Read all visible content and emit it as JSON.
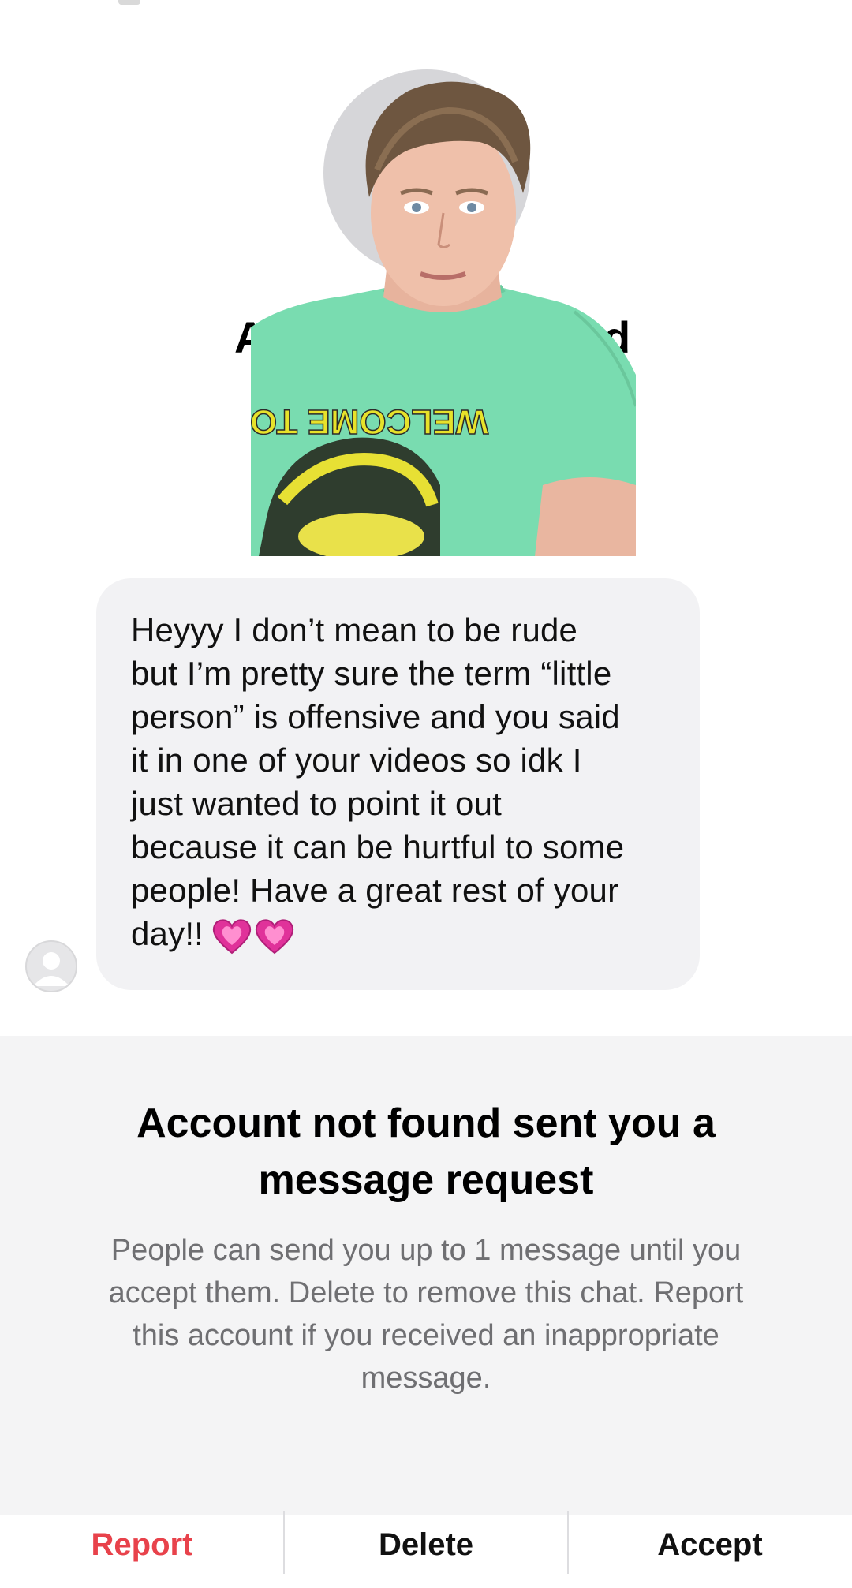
{
  "profile": {
    "name_left": "A",
    "name_right": "d"
  },
  "message": {
    "text": "Heyyy I don’t mean to be rude but I’m pretty sure the term “little person” is offensive and you said it in one of your videos so idk I just wanted to point it out because it can be hurtful to some people! Have a great rest of your day!!",
    "lines": [
      "Heyyy I don’t mean to be rude",
      "but I’m pretty sure the term “little",
      "person” is offensive and you said",
      "it in one of your videos so idk I",
      "just wanted to point it out",
      "because it can be hurtful to some",
      "people! Have a great rest of your",
      "day!!"
    ]
  },
  "shirt_text": "WELCOME TO",
  "request": {
    "title_line1": "Account not found sent you a",
    "title_line2": "message request",
    "body_line1": "People can send you up to 1 message until you",
    "body_line2": "accept them. Delete to remove this chat. Report",
    "body_line3": "this account if you received an inappropriate",
    "body_line4": "message.",
    "report_label": "Report",
    "delete_label": "Delete",
    "accept_label": "Accept"
  },
  "colors": {
    "report": "#e8424b",
    "bubble": "#f2f2f4",
    "panel": "#f4f4f5",
    "heart": "#e0329a"
  },
  "icons": {
    "avatar": "default-avatar-icon",
    "hearts": "growing-heart-emoji"
  }
}
